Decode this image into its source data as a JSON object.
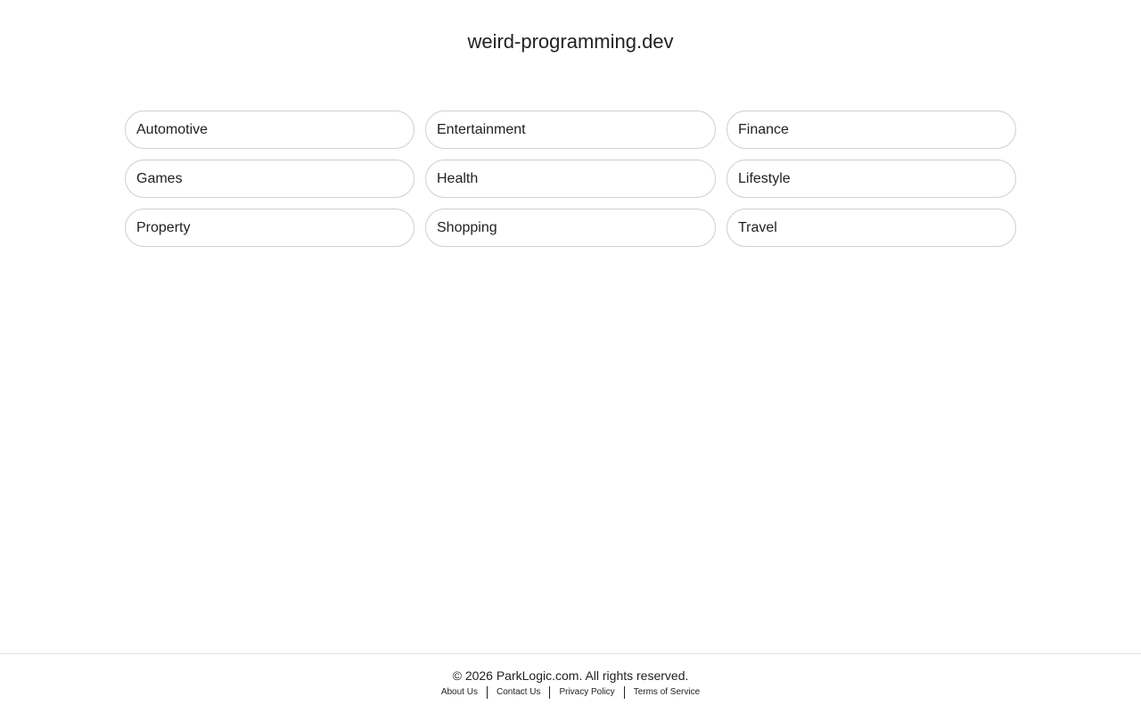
{
  "site": {
    "title": "weird-programming.dev"
  },
  "categories": [
    {
      "label": "Automotive"
    },
    {
      "label": "Entertainment"
    },
    {
      "label": "Finance"
    },
    {
      "label": "Games"
    },
    {
      "label": "Health"
    },
    {
      "label": "Lifestyle"
    },
    {
      "label": "Property"
    },
    {
      "label": "Shopping"
    },
    {
      "label": "Travel"
    }
  ],
  "footer": {
    "copyright": "© 2026 ParkLogic.com. All rights reserved.",
    "links": [
      {
        "label": "About Us"
      },
      {
        "label": "Contact Us"
      },
      {
        "label": "Privacy Policy"
      },
      {
        "label": "Terms of Service"
      }
    ]
  }
}
